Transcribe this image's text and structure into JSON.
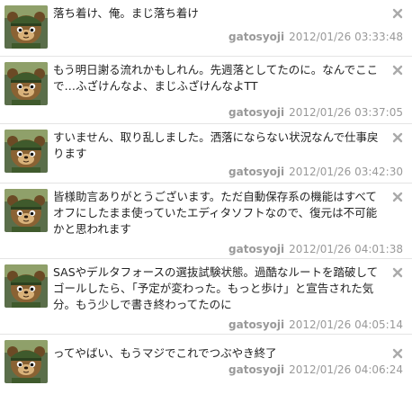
{
  "tweets": [
    {
      "text": "落ち着け、俺。まじ落ち着け",
      "username": "gatosyoji",
      "timestamp": "2012/01/26 03:33:48",
      "close_icon": "close-icon"
    },
    {
      "text": "もう明日謝る流れかもしれん。先週落としてたのに。なんでここで…ふざけんなよ、まじふざけんなよTT",
      "username": "gatosyoji",
      "timestamp": "2012/01/26 03:37:05",
      "close_icon": "close-icon"
    },
    {
      "text": "すいません、取り乱しました。洒落にならない状況なんで仕事戻ります",
      "username": "gatosyoji",
      "timestamp": "2012/01/26 03:42:30",
      "close_icon": "close-icon"
    },
    {
      "text": "皆様助言ありがとうございます。ただ自動保存系の機能はすべてオフにしたまま使っていたエディタソフトなので、復元は不可能かと思われます",
      "username": "gatosyoji",
      "timestamp": "2012/01/26 04:01:38",
      "close_icon": "close-icon"
    },
    {
      "text": "SASやデルタフォースの選抜試験状態。過酷なルートを踏破してゴールしたら、「予定が変わった。もっと歩け」と宣告された気分。もう少しで書き終わってたのに",
      "username": "gatosyoji",
      "timestamp": "2012/01/26 04:05:14",
      "close_icon": "close-icon"
    },
    {
      "text": "ってやばい、もうマジでこれでつぶやき終了",
      "username": "gatosyoji",
      "timestamp": "2012/01/26 04:06:24",
      "close_icon": "close-icon"
    }
  ],
  "colors": {
    "text": "#222222",
    "meta": "#999999",
    "divider": "#e4e4e4",
    "close": "#aaaaaa"
  }
}
